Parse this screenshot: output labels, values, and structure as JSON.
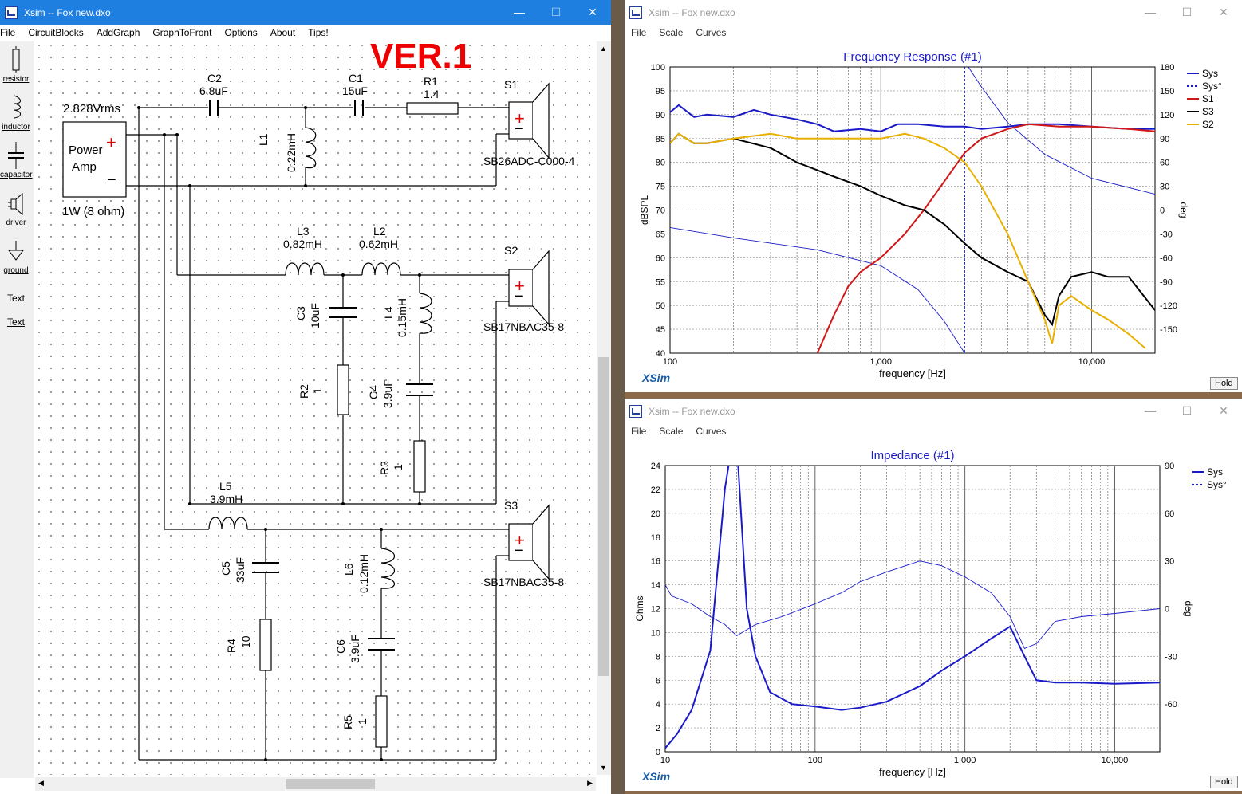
{
  "schematic": {
    "title": "Xsim -- Fox new.dxo",
    "menu": [
      "File",
      "CircuitBlocks",
      "AddGraph",
      "GraphToFront",
      "Options",
      "About",
      "Tips!"
    ],
    "tools": [
      "resistor",
      "inductor",
      "capacitor",
      "driver",
      "ground",
      "Text",
      "Text"
    ],
    "banner": "VER.1",
    "amp": {
      "voltage": "2.828Vrms",
      "label1": "Power",
      "label2": "Amp",
      "note": "1W (8 ohm)"
    },
    "components": {
      "C2": {
        "name": "C2",
        "value": "6.8uF"
      },
      "C1": {
        "name": "C1",
        "value": "15uF"
      },
      "R1": {
        "name": "R1",
        "value": "1.4"
      },
      "L1": {
        "name": "L1",
        "value": "0.22mH"
      },
      "L3": {
        "name": "L3",
        "value": "0.82mH"
      },
      "L2": {
        "name": "L2",
        "value": "0.62mH"
      },
      "C3": {
        "name": "C3",
        "value": "10uF"
      },
      "L4": {
        "name": "L4",
        "value": "0.15mH"
      },
      "R2": {
        "name": "R2",
        "value": "1"
      },
      "C4": {
        "name": "C4",
        "value": "3.9uF"
      },
      "R3": {
        "name": "R3",
        "value": "1"
      },
      "L5": {
        "name": "L5",
        "value": "3.9mH"
      },
      "C5": {
        "name": "C5",
        "value": "33uF"
      },
      "L6": {
        "name": "L6",
        "value": "0.12mH"
      },
      "R4": {
        "name": "R4",
        "value": "10"
      },
      "C6": {
        "name": "C6",
        "value": "3.9uF"
      },
      "R5": {
        "name": "R5",
        "value": "1"
      }
    },
    "drivers": [
      {
        "name": "S1",
        "model": "SB26ADC-C000-4"
      },
      {
        "name": "S2",
        "model": "SB17NBAC35-8"
      },
      {
        "name": "S3",
        "model": "SB17NBAC35-8"
      }
    ]
  },
  "freq_window": {
    "title": "Xsim -- Fox new.dxo",
    "menu": [
      "File",
      "Scale",
      "Curves"
    ],
    "hold": "Hold",
    "logo": "XSim"
  },
  "imp_window": {
    "title": "Xsim -- Fox new.dxo",
    "menu": [
      "File",
      "Scale",
      "Curves"
    ],
    "hold": "Hold",
    "logo": "XSim"
  },
  "chart_data": [
    {
      "type": "line",
      "title": "Frequency Response (#1)",
      "xlabel": "frequency [Hz]",
      "ylabel": "dBSPL",
      "y2label": "deg",
      "xscale": "log",
      "xlim": [
        100,
        20000
      ],
      "ylim": [
        40,
        100
      ],
      "y2lim": [
        -180,
        180
      ],
      "x_tick_labels": [
        "100",
        "1,000",
        "10,000"
      ],
      "y_ticks": [
        40,
        45,
        50,
        55,
        60,
        65,
        70,
        75,
        80,
        85,
        90,
        95,
        100
      ],
      "y2_ticks": [
        -150,
        -120,
        -90,
        -60,
        -30,
        0,
        30,
        60,
        90,
        120,
        150,
        180
      ],
      "grid": true,
      "marker_x": 2500,
      "legend_position": "top-right",
      "series": [
        {
          "name": "Sys",
          "color": "#1a1ac8",
          "axis": "left",
          "style": "solid",
          "x": [
            100,
            110,
            130,
            150,
            200,
            250,
            300,
            400,
            500,
            600,
            800,
            1000,
            1200,
            1500,
            2000,
            2500,
            3000,
            4000,
            5000,
            7000,
            10000,
            15000,
            20000
          ],
          "y": [
            90.5,
            92,
            89.5,
            90,
            89.5,
            91,
            90,
            89,
            88,
            86.5,
            87,
            86.5,
            88,
            88,
            87.5,
            87.5,
            87,
            87.5,
            88,
            88,
            87.5,
            87,
            87
          ]
        },
        {
          "name": "Sys°",
          "color": "#1a1ac8",
          "axis": "right",
          "style": "dashed",
          "x": [
            100,
            200,
            500,
            1000,
            1500,
            2000,
            2500,
            2600,
            3000,
            4000,
            6000,
            10000,
            20000
          ],
          "y": [
            -22,
            -35,
            -50,
            -70,
            -100,
            -140,
            -180,
            180,
            155,
            110,
            70,
            40,
            20
          ]
        },
        {
          "name": "S1",
          "color": "#d01818",
          "axis": "left",
          "style": "solid",
          "x": [
            500,
            600,
            700,
            800,
            1000,
            1300,
            1600,
            2000,
            2500,
            3000,
            4000,
            5000,
            7000,
            10000,
            15000,
            20000
          ],
          "y": [
            40,
            48,
            54,
            57,
            60,
            65,
            70,
            76,
            82,
            85,
            87,
            88,
            87.5,
            87.5,
            87,
            86.5
          ]
        },
        {
          "name": "S3",
          "color": "#000000",
          "axis": "left",
          "style": "solid",
          "x": [
            100,
            110,
            130,
            150,
            200,
            300,
            400,
            600,
            800,
            1000,
            1300,
            1600,
            2000,
            2500,
            3000,
            4000,
            5000,
            6000,
            6500,
            7000,
            8000,
            10000,
            12000,
            15000,
            20000
          ],
          "y": [
            84,
            86,
            84,
            84,
            85,
            83,
            80,
            77,
            75,
            73,
            71,
            70,
            67,
            63,
            60,
            57,
            55,
            48,
            46,
            52,
            56,
            57,
            56,
            56,
            49
          ]
        },
        {
          "name": "S2",
          "color": "#e8b000",
          "axis": "left",
          "style": "solid",
          "x": [
            100,
            110,
            130,
            150,
            200,
            300,
            400,
            500,
            700,
            1000,
            1300,
            1600,
            2000,
            2500,
            3000,
            4000,
            5000,
            6000,
            6500,
            7000,
            8000,
            10000,
            12000,
            15000,
            18000
          ],
          "y": [
            84,
            86,
            84,
            84,
            85,
            86,
            85,
            85,
            85,
            85,
            86,
            85,
            83,
            80,
            75,
            65,
            55,
            47,
            42,
            50,
            52,
            49,
            47,
            44,
            41
          ]
        }
      ]
    },
    {
      "type": "line",
      "title": "Impedance (#1)",
      "xlabel": "frequency [Hz]",
      "ylabel": "Ohms",
      "y2label": "deg",
      "xscale": "log",
      "xlim": [
        10,
        20000
      ],
      "ylim": [
        0,
        24
      ],
      "y2lim": [
        -90,
        90
      ],
      "x_tick_labels": [
        "10",
        "100",
        "1,000",
        "10,000"
      ],
      "y_ticks": [
        0,
        2,
        4,
        6,
        8,
        10,
        12,
        14,
        16,
        18,
        20,
        22,
        24
      ],
      "y2_ticks": [
        -60,
        -30,
        0,
        30,
        60,
        90
      ],
      "grid": true,
      "legend_position": "top-right",
      "series": [
        {
          "name": "Sys",
          "color": "#1a1ac8",
          "axis": "left",
          "style": "solid",
          "x": [
            10,
            12,
            15,
            20,
            25,
            28,
            30,
            35,
            40,
            50,
            70,
            100,
            150,
            200,
            300,
            500,
            700,
            1000,
            1500,
            2000,
            2500,
            3000,
            4000,
            6000,
            10000,
            20000
          ],
          "y": [
            0.3,
            1.5,
            3.5,
            8.5,
            22,
            26,
            26,
            12,
            8,
            5,
            4,
            3.8,
            3.5,
            3.7,
            4.2,
            5.5,
            6.8,
            8,
            9.5,
            10.5,
            8,
            6,
            5.8,
            5.8,
            5.7,
            5.8
          ]
        },
        {
          "name": "Sys°",
          "color": "#1a1ac8",
          "axis": "right",
          "style": "dashed",
          "x": [
            10,
            11,
            15,
            20,
            25,
            30,
            40,
            60,
            100,
            150,
            200,
            300,
            500,
            700,
            1000,
            1500,
            2000,
            2500,
            3000,
            4000,
            6000,
            10000,
            20000
          ],
          "y": [
            15,
            8,
            3,
            -5,
            -10,
            -17,
            -10,
            -5,
            3,
            10,
            17,
            23,
            30,
            27,
            20,
            10,
            -5,
            -25,
            -22,
            -8,
            -5,
            -3,
            0
          ]
        }
      ]
    }
  ]
}
